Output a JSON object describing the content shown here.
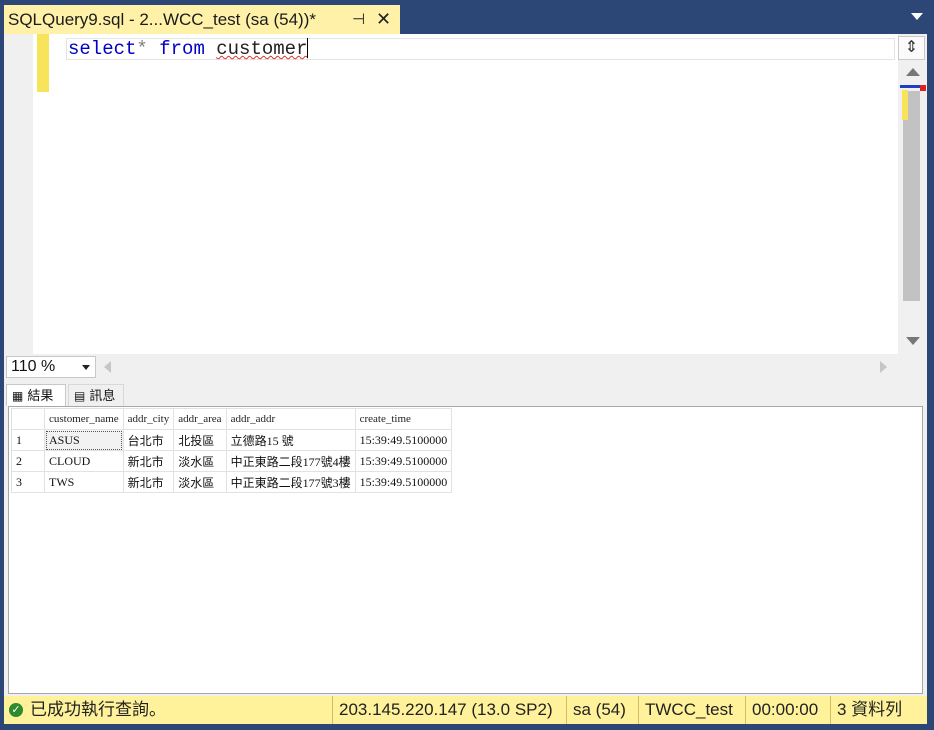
{
  "tab": {
    "title": "SQLQuery9.sql - 2...WCC_test (sa (54))*",
    "pin_icon": "pin-icon",
    "close_icon": "close-icon"
  },
  "editor": {
    "keyword_select": "select",
    "star": "*",
    "keyword_from": "from",
    "table_name": "customer"
  },
  "zoom": {
    "value": "110 %"
  },
  "results": {
    "tab_results": "結果",
    "tab_messages": "訊息",
    "columns": [
      "customer_name",
      "addr_city",
      "addr_area",
      "addr_addr",
      "create_time"
    ],
    "rows": [
      {
        "n": "1",
        "cells": [
          "ASUS",
          "台北市",
          "北投區",
          "立德路15 號",
          "15:39:49.5100000"
        ]
      },
      {
        "n": "2",
        "cells": [
          "CLOUD",
          "新北市",
          "淡水區",
          "中正東路二段177號4樓",
          "15:39:49.5100000"
        ]
      },
      {
        "n": "3",
        "cells": [
          "TWS",
          "新北市",
          "淡水區",
          "中正東路二段177號3樓",
          "15:39:49.5100000"
        ]
      }
    ]
  },
  "status": {
    "message": "已成功執行查詢。",
    "server": "203.145.220.147 (13.0 SP2)",
    "user": "sa (54)",
    "database": "TWCC_test",
    "elapsed": "00:00:00",
    "rows": "3 資料列"
  },
  "colors": {
    "tab_bg": "#fff2a8",
    "status_bg": "#fff29a",
    "frame": "#2c4775",
    "keyword": "#0000c8"
  }
}
